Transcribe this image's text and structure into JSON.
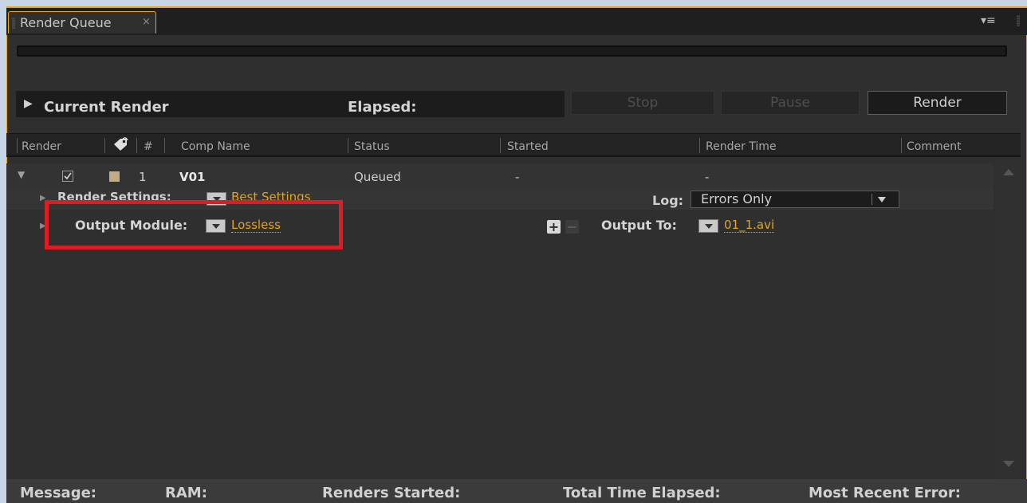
{
  "panel": {
    "tab_label": "Render Queue",
    "tab_close": "×",
    "menu_icon": "▾≡"
  },
  "current_render": {
    "arrow": "▶",
    "title": "Current Render",
    "elapsed_label": "Elapsed:",
    "stop_label": "Stop",
    "pause_label": "Pause",
    "render_label": "Render"
  },
  "columns": {
    "render": "Render",
    "number": "#",
    "comp_name": "Comp Name",
    "status": "Status",
    "started": "Started",
    "render_time": "Render Time",
    "comment": "Comment"
  },
  "item": {
    "expand": "▼",
    "number": "1",
    "comp_name": "V01",
    "status": "Queued",
    "started": "-",
    "render_time": "-",
    "checked": true,
    "label_color": "#c4ac82"
  },
  "render_settings": {
    "label": "Render Settings:",
    "value": "Best Settings",
    "log_label": "Log:",
    "log_value": "Errors Only"
  },
  "output_module": {
    "label": "Output Module:",
    "value": "Lossless",
    "add_label": "+",
    "remove_label": "−",
    "output_to_label": "Output To:",
    "output_to_value": "01_1.avi"
  },
  "footer": {
    "message": "Message:",
    "ram": "RAM:",
    "renders_started": "Renders Started:",
    "total_time": "Total Time Elapsed:",
    "recent_error": "Most Recent Error:"
  },
  "colors": {
    "accent": "#e8a415",
    "link": "#e2a51c",
    "highlight": "#de1c24",
    "screen_background": "#c7d6e6"
  }
}
